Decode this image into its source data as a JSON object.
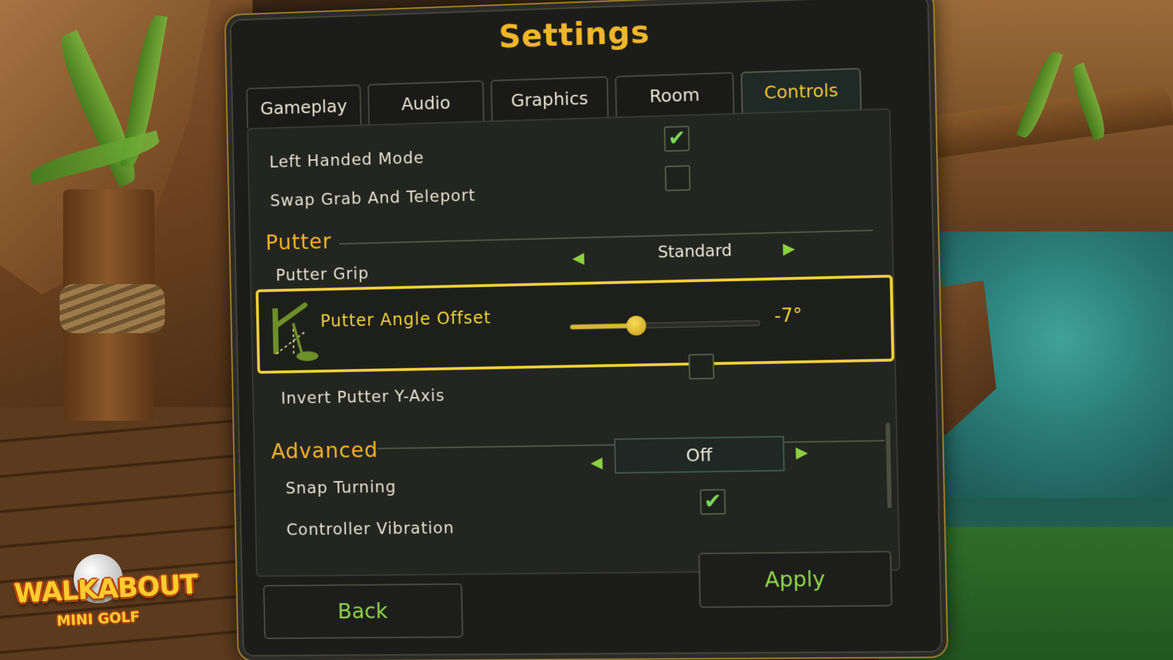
{
  "window": {
    "title": "Settings"
  },
  "tabs": [
    {
      "label": "Gameplay",
      "active": false
    },
    {
      "label": "Audio",
      "active": false
    },
    {
      "label": "Graphics",
      "active": false
    },
    {
      "label": "Room",
      "active": false
    },
    {
      "label": "Controls",
      "active": true
    }
  ],
  "general": {
    "left_handed_mode": {
      "label": "Left Handed Mode",
      "checked": true
    },
    "swap_grab_teleport": {
      "label": "Swap Grab And Teleport",
      "checked": false
    }
  },
  "putter": {
    "section_title": "Putter",
    "grip": {
      "label": "Putter Grip",
      "value": "Standard"
    },
    "angle_offset": {
      "label": "Putter Angle Offset",
      "value_text": "-7°",
      "slider_fraction": 0.35
    },
    "invert_y": {
      "label": "Invert Putter Y-Axis",
      "checked": false
    }
  },
  "advanced": {
    "section_title": "Advanced",
    "snap_turning": {
      "label": "Snap Turning",
      "value": "Off"
    },
    "controller_vibration": {
      "label": "Controller Vibration",
      "checked": true
    }
  },
  "buttons": {
    "back": "Back",
    "apply": "Apply"
  },
  "logo": {
    "line1": "WALKABOUT",
    "line2": "MINI GOLF"
  },
  "icons": {
    "check": "✔",
    "arrow_left": "◀",
    "arrow_right": "▶",
    "putter": "putter-icon"
  },
  "colors": {
    "accent_gold": "#f2b62b",
    "highlight_yellow": "#f3d33a",
    "button_green": "#8fd64a",
    "check_green": "#7ed957"
  }
}
